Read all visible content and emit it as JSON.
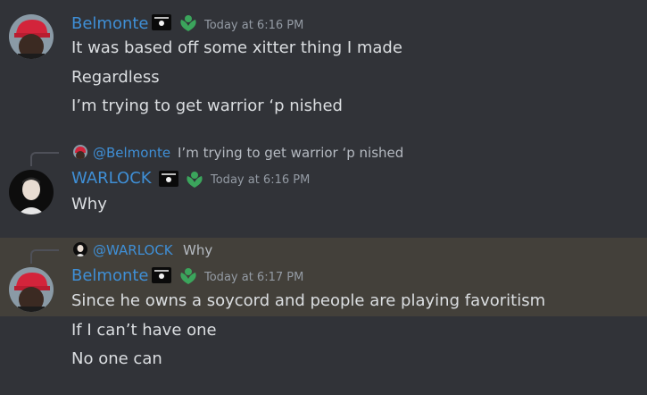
{
  "messages": [
    {
      "author": "Belmonte",
      "timestamp": "Today at 6:16 PM",
      "lines": [
        "It was based off some xitter thing I made",
        "Regardless",
        "I’m trying to get warrior ‘p nished"
      ]
    },
    {
      "reply": {
        "author": "@Belmonte",
        "text": "I’m trying to get warrior ‘p nished"
      },
      "author": "WARLOCK",
      "timestamp": "Today at 6:16 PM",
      "lines": [
        "Why"
      ]
    },
    {
      "reply": {
        "author": "@WARLOCK",
        "text": "Why"
      },
      "author": "Belmonte",
      "timestamp": "Today at 6:17 PM",
      "lines": [
        "Since he owns a soycord and people are playing favoritism",
        "If I can’t have one",
        "No one can"
      ]
    }
  ],
  "colors": {
    "background": "#313338",
    "highlight": "#43403a",
    "username": "#3f8fd6",
    "text": "#dbdee1",
    "timestamp": "#949ba4",
    "badge_green": "#3ba55c"
  },
  "icons": [
    "black-flag-badge-icon",
    "green-leaf-badge-icon"
  ]
}
